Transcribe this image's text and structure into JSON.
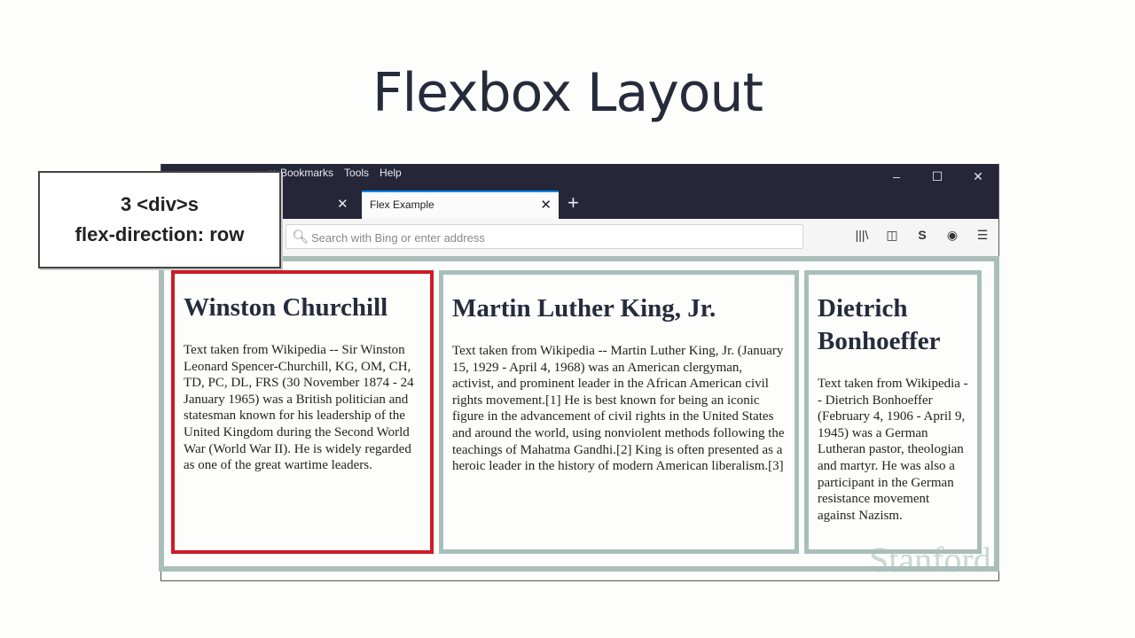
{
  "slide": {
    "title": "Flexbox Layout"
  },
  "annotation": {
    "line1": "3 <div>s",
    "line2": "flex-direction: row"
  },
  "browser": {
    "menu": [
      "Bookmarks",
      "Tools",
      "Help"
    ],
    "window_controls": {
      "minimize": "–",
      "maximize": "☐",
      "close": "✕"
    },
    "tabs": {
      "active_label": "Flex Example",
      "close_glyph": "✕",
      "new_tab_glyph": "+"
    },
    "address_bar": {
      "placeholder": "Search with Bing or enter address"
    },
    "toolbar_icons": [
      "library-icon",
      "sidebar-icon",
      "s-extension-icon",
      "account-icon",
      "hamburger-menu-icon"
    ]
  },
  "cards": [
    {
      "title": "Winston Churchill",
      "text": "Text taken from Wikipedia -- Sir Winston Leonard Spencer-Churchill, KG, OM, CH, TD, PC, DL, FRS (30 November 1874 - 24 January 1965) was a British politician and statesman known for his leadership of the United Kingdom during the Second World War (World War II). He is widely regarded as one of the great wartime leaders."
    },
    {
      "title": "Martin Luther King, Jr.",
      "text": "Text taken from Wikipedia -- Martin Luther King, Jr. (January 15, 1929 - April 4, 1968) was an American clergyman, activist, and prominent leader in the African American civil rights movement.[1] He is best known for being an iconic figure in the advancement of civil rights in the United States and around the world, using nonviolent methods following the teachings of Mahatma Gandhi.[2] King is often presented as a heroic leader in the history of modern American liberalism.[3]"
    },
    {
      "title": "Dietrich Bonhoeffer",
      "text": "Text taken from Wikipedia -- Dietrich Bonhoeffer (February 4, 1906 - April 9, 1945) was a German Lutheran pastor, theologian and martyr. He was also a participant in the German resistance movement against Nazism."
    }
  ],
  "watermark": "Stanford",
  "colors": {
    "highlight": "#cc1c25",
    "box": "#a9bebb",
    "chrome": "#252637",
    "tab_accent": "#0a84ff"
  }
}
